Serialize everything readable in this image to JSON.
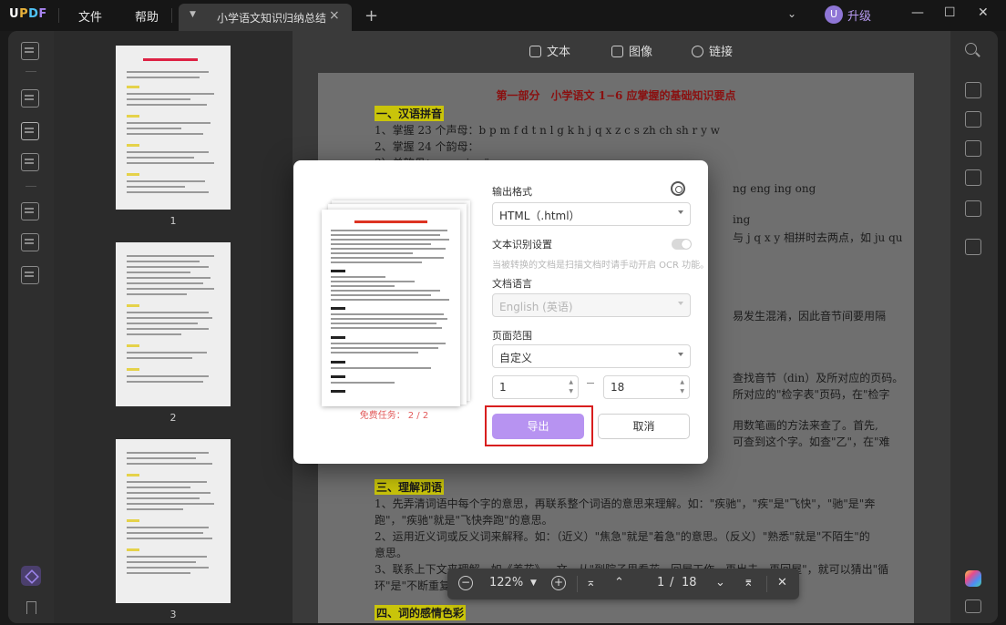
{
  "titlebar": {
    "logo": {
      "u": "U",
      "p": "P",
      "d": "D",
      "f": "F"
    },
    "menu_file": "文件",
    "menu_help": "帮助",
    "tab_name": "小学语文知识归纳总结",
    "tab_close": "×",
    "new_tab": "+",
    "avatar_letter": "U",
    "upgrade": "升级",
    "min": "—",
    "max": "☐",
    "close": "✕"
  },
  "toolbar": {
    "text": "文本",
    "image": "图像",
    "link": "链接"
  },
  "thumbnails": [
    {
      "num": "1"
    },
    {
      "num": "2"
    },
    {
      "num": "3"
    }
  ],
  "page": {
    "heading": "第一部分　小学语文 1−6 应掌握的基础知识要点",
    "sec1": "一、汉语拼音",
    "l1": "1、掌握 23 个声母：b p m f d t n l g k h j q x z c s zh ch sh r y w",
    "l2": "2、掌握 24 个韵母：",
    "l3": "3）单韵母：a o e i u ü",
    "r1": "ng eng ing ong",
    "r2": "ing",
    "r3": "与 j q x y 相拼时去两点，如 ju qu",
    "r4": "易发生混淆，因此音节间要用隔",
    "r5": "查找音节（din）及所对应的页码。",
    "r6": "所对应的\"检字表\"页码，在\"检字",
    "r7": "用数笔画的方法来查了。首先,",
    "r8": "可查到这个字。如查\"乙\"，在\"难",
    "sec3": "三、理解词语",
    "m1": "1、先弄清词语中每个字的意思，再联系整个词语的意思来理解。如：\"疾驰\"，\"疾\"是\"飞快\"，\"驰\"是\"奔",
    "m2": "跑\"，\"疾驰\"就是\"飞快奔跑\"的意思。",
    "m3": "2、运用近义词或反义词来解释。如：（近义）\"焦急\"就是\"着急\"的意思。（反义）\"熟悉\"就是\"不陌生\"的",
    "m4": "意思。",
    "m5": "3、联系上下文来理解。如《养花》一文，从\"到院子里看花—回屋工作—再出去—再回屋\"，就可以猜出\"循",
    "m6": "环\"是\"不断重复",
    "sec4": "四、词的感情色彩"
  },
  "navbar": {
    "zoom_out": "−",
    "zoom": "122%",
    "zoom_in": "+",
    "current_page": "1",
    "slash": "/",
    "total_pages": "18",
    "close": "✕"
  },
  "dialog": {
    "output_format_label": "输出格式",
    "output_format": "HTML（.html）",
    "ocr_label": "文本识别设置",
    "ocr_hint": "当被转换的文档是扫描文档时请手动开启 OCR 功能。",
    "doc_lang_label": "文档语言",
    "doc_lang": "English (英语)",
    "page_range_label": "页面范围",
    "page_range": "自定义",
    "range_from": "1",
    "range_to": "18",
    "free_task_label": "免费任务：",
    "free_task_count": "2 / 2",
    "export": "导出",
    "cancel": "取消"
  },
  "colors": {
    "accent": "#b793f1",
    "highlight": "#d81e1e",
    "upgrade": "#b79bf2"
  }
}
